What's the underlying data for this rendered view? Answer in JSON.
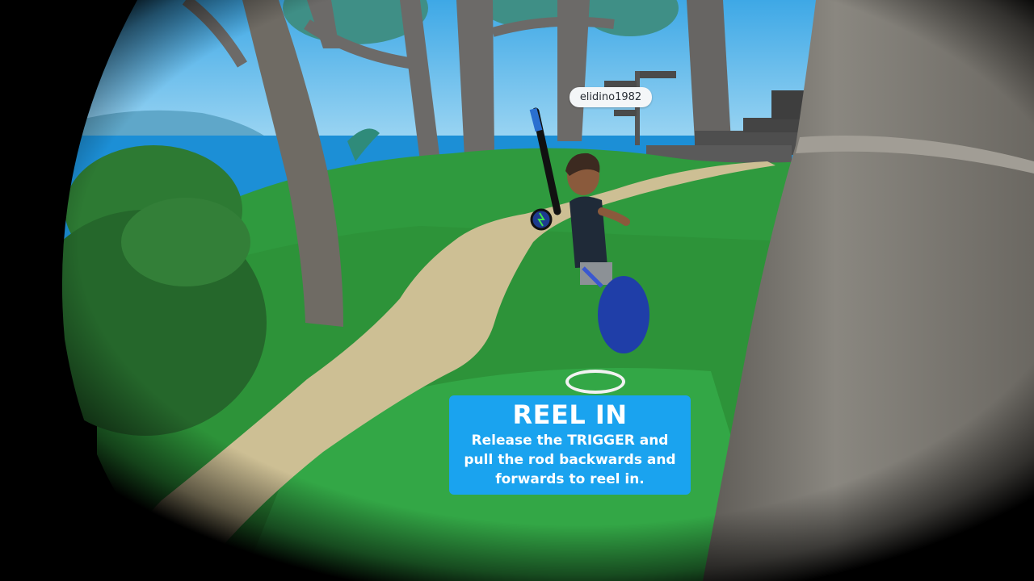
{
  "player": {
    "username": "elidino1982"
  },
  "instruction": {
    "title": "REEL IN",
    "body": "Release the TRIGGER and pull the rod backwards and forwards to reel in."
  },
  "colors": {
    "sky": "#7fc9f0",
    "ocean": "#1c8fd6",
    "grass": "#2e9a3e",
    "path": "#cdbf94",
    "tooltip": "#1aa3ef",
    "trunk": "#6e6a64"
  }
}
